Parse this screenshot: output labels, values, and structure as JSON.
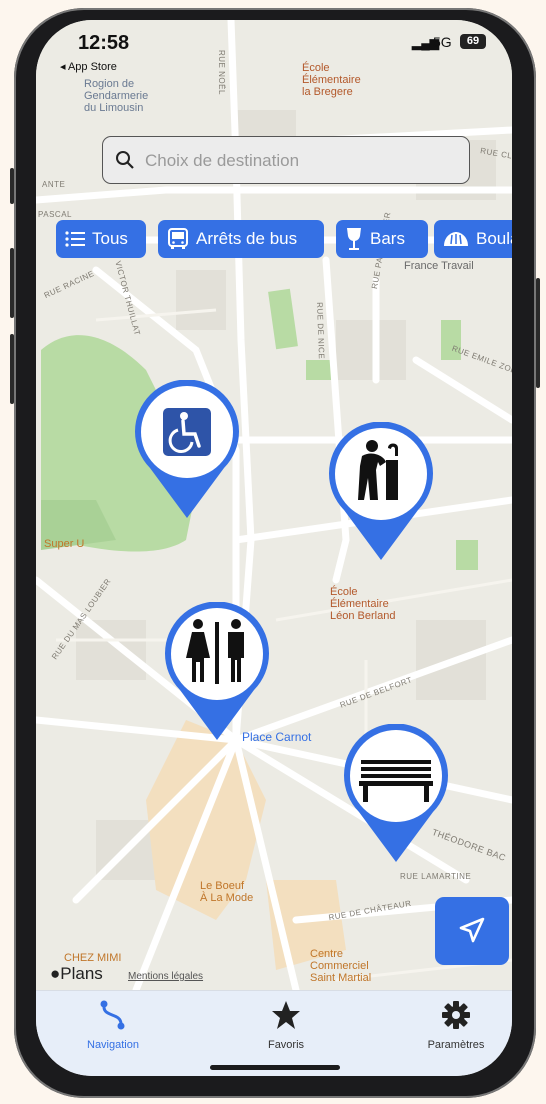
{
  "status_bar": {
    "time": "12:58",
    "back_app": "◂ App Store",
    "signal": "▂▄▆",
    "network": "5G",
    "battery": "69"
  },
  "search": {
    "placeholder": "Choix de destination"
  },
  "filters": [
    {
      "label": "Tous",
      "icon": "list-icon"
    },
    {
      "label": "Arrêts de bus",
      "icon": "bus-icon"
    },
    {
      "label": "Bars",
      "icon": "wine-glass-icon"
    },
    {
      "label": "Boular",
      "icon": "bread-icon"
    }
  ],
  "map": {
    "places": {
      "gendarmerie": "Rogion de\nGendarmerie\ndu Limousin",
      "ecole_bregere": "École\nÉlémentaire\nla Bregere",
      "france_travail": "France Travail",
      "super_u": "Super U",
      "ecole_berland": "École\nÉlémentaire\nLéon Berland",
      "place_carnot": "Place Carnot",
      "boeuf": "Le Boeuf\nÀ La Mode",
      "chez_mimi": "CHEZ MIMI",
      "centre": "Centre\nCommerciel\nSaint Martial"
    },
    "streets": {
      "noel": "RUE NOËL",
      "clem": "RUE CLEM",
      "ante": "ANTE",
      "pascal": "PASCAL",
      "racine": "RUE RACINE",
      "victor": "VICTOR THUILLAT",
      "nice": "RUE DE NICE",
      "parmentier": "RUE PARMENTIER",
      "zola": "RUE EMILE ZOLA",
      "mas": "RUE DU MAS LOUBIER",
      "belfort": "RUE DE BELFORT",
      "bac": "THÉODORE BAC",
      "lamartine": "RUE LAMARTINE",
      "chateau": "RUE DE CHÂTEAUR"
    },
    "markers": [
      "wheelchair-accessible-icon",
      "drinking-fountain-icon",
      "restroom-icon",
      "bench-icon"
    ],
    "attribution": {
      "brand": "Plans",
      "legal": "Mentions légales"
    }
  },
  "tabs": [
    {
      "label": "Navigation",
      "icon": "route-icon",
      "active": true
    },
    {
      "label": "Favoris",
      "icon": "star-icon",
      "active": false
    },
    {
      "label": "Paramètres",
      "icon": "gear-icon",
      "active": false
    }
  ],
  "colors": {
    "accent": "#3570e4",
    "background": "#fdf6ee",
    "park": "#b8dba4",
    "marker_fill": "#ffffff"
  }
}
